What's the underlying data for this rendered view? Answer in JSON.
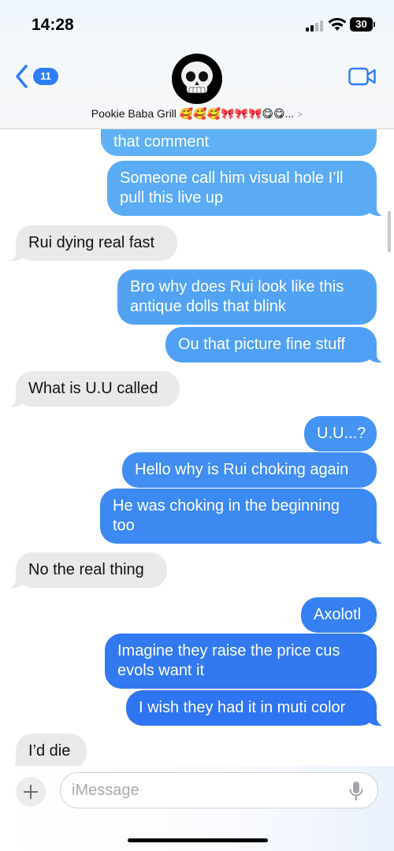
{
  "status_bar": {
    "time": "14:28",
    "battery": "30"
  },
  "header": {
    "back_badge": "11",
    "contact_name": "Pookie Baba Grill 🥰🥰🥰🎀🎀🎀😋😋...",
    "chevron": ">",
    "avatar_icon": "skull-icon",
    "video_icon": "video-camera-icon"
  },
  "messages": [
    {
      "dir": "out",
      "text": "that comment"
    },
    {
      "dir": "out",
      "text": "Someone call him visual hole I’ll pull this live up"
    },
    {
      "dir": "in",
      "text": "Rui dying real fast"
    },
    {
      "dir": "out",
      "text": "Bro why does Rui look like this antique dolls that blink"
    },
    {
      "dir": "out",
      "text": "Ou that picture fine stuff"
    },
    {
      "dir": "in",
      "text": "What is U.U called"
    },
    {
      "dir": "out",
      "text": "U.U...?"
    },
    {
      "dir": "out",
      "text": "Hello why is Rui choking again"
    },
    {
      "dir": "out",
      "text": "He was choking in the beginning too"
    },
    {
      "dir": "in",
      "text": "No the real thing"
    },
    {
      "dir": "out",
      "text": "Axolotl"
    },
    {
      "dir": "out",
      "text": "Imagine they raise the price cus evols want it"
    },
    {
      "dir": "out",
      "text": "I wish they had it in muti color"
    },
    {
      "dir": "in",
      "text": "I’d die"
    }
  ],
  "input": {
    "placeholder": "iMessage",
    "value": ""
  },
  "colors": {
    "accent": "#2f7df6",
    "incoming_bubble": "#e9e9eb",
    "outgoing_gradient_top": "#5cacf4",
    "outgoing_gradient_bottom": "#2f6ff0"
  }
}
